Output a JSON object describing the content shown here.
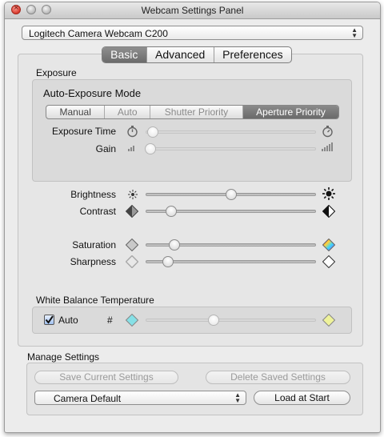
{
  "window": {
    "title": "Webcam Settings Panel"
  },
  "camera_select": {
    "value": "Logitech Camera Webcam C200"
  },
  "tabs": [
    "Basic",
    "Advanced",
    "Preferences"
  ],
  "selected_tab": "Basic",
  "exposure": {
    "title": "Exposure",
    "mode_label": "Auto-Exposure Mode",
    "modes": [
      "Manual",
      "Auto",
      "Shutter Priority",
      "Aperture Priority"
    ],
    "selected_mode": "Aperture Priority",
    "exposure_time_label": "Exposure Time",
    "gain_label": "Gain"
  },
  "sliders": {
    "brightness": {
      "label": "Brightness",
      "value": 0.5
    },
    "contrast": {
      "label": "Contrast",
      "value": 0.15
    },
    "saturation": {
      "label": "Saturation",
      "value": 0.17
    },
    "sharpness": {
      "label": "Sharpness",
      "value": 0.13
    },
    "exposure_time": {
      "value": 0.04
    },
    "gain": {
      "value": 0.03
    },
    "white_balance": {
      "value": 0.4
    }
  },
  "white_balance": {
    "title": "White Balance Temperature",
    "auto_label": "Auto",
    "auto_checked": true,
    "hash_label": "#"
  },
  "manage": {
    "title": "Manage Settings",
    "save_label": "Save Current Settings",
    "delete_label": "Delete Saved Settings",
    "preset_value": "Camera Default",
    "load_label": "Load at Start"
  },
  "colors": {
    "selected_segment": "#777777",
    "window_bg": "#ececec",
    "checkbox_blue": "#9fc0ef"
  },
  "icons": [
    "close-icon",
    "minimize-icon",
    "zoom-icon",
    "stopwatch-icon",
    "signal-bars-icon",
    "sun-icon",
    "contrast-icon",
    "saturation-icon",
    "sharpness-icon",
    "white-balance-icon",
    "popup-arrows-icon"
  ]
}
